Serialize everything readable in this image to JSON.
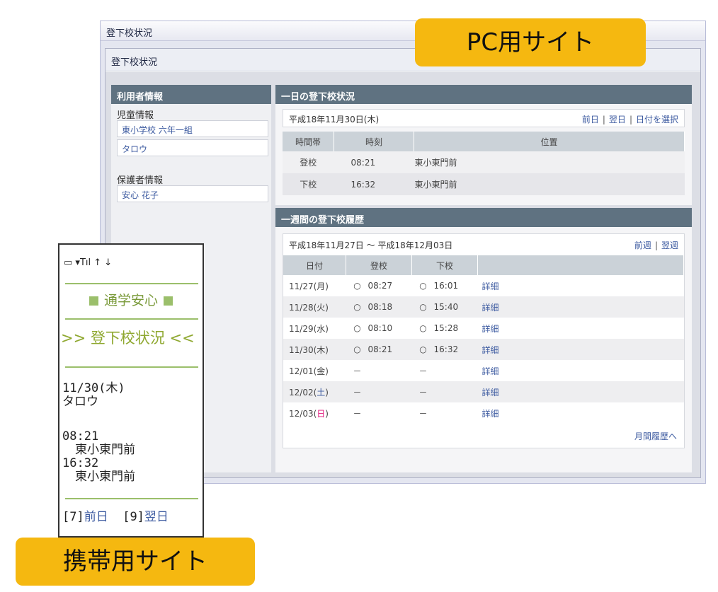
{
  "pc": {
    "window_title": "登下校状況",
    "page_header": "登下校状況",
    "user_panel": {
      "title": "利用者情報",
      "child_label": "児童情報",
      "child_school": "東小学校 六年一組",
      "child_name": "タロウ",
      "guardian_label": "保護者情報",
      "guardian_name": "安心 花子"
    },
    "daily": {
      "title": "一日の登下校状況",
      "date": "平成18年11月30日(木)",
      "nav": [
        "前日",
        "翌日",
        "日付を選択"
      ],
      "nav_sep": "|",
      "headers": [
        "時間帯",
        "時刻",
        "位置"
      ],
      "rows": [
        {
          "period": "登校",
          "time": "08:21",
          "place": "東小東門前"
        },
        {
          "period": "下校",
          "time": "16:32",
          "place": "東小東門前"
        }
      ]
    },
    "weekly": {
      "title": "一週間の登下校履歴",
      "range": "平成18年11月27日 ～ 平成18年12月03日",
      "nav": [
        "前週",
        "翌週"
      ],
      "nav_sep": "|",
      "headers": [
        "日付",
        "登校",
        "下校",
        ""
      ],
      "rows": [
        {
          "date": "11/27",
          "dow": "月",
          "dow_class": "",
          "in_mark": "○",
          "in_time": "08:27",
          "out_mark": "○",
          "out_time": "16:01",
          "detail": "詳細"
        },
        {
          "date": "11/28",
          "dow": "火",
          "dow_class": "",
          "in_mark": "○",
          "in_time": "08:18",
          "out_mark": "○",
          "out_time": "15:40",
          "detail": "詳細"
        },
        {
          "date": "11/29",
          "dow": "水",
          "dow_class": "",
          "in_mark": "○",
          "in_time": "08:10",
          "out_mark": "○",
          "out_time": "15:28",
          "detail": "詳細"
        },
        {
          "date": "11/30",
          "dow": "木",
          "dow_class": "",
          "in_mark": "○",
          "in_time": "08:21",
          "out_mark": "○",
          "out_time": "16:32",
          "detail": "詳細"
        },
        {
          "date": "12/01",
          "dow": "金",
          "dow_class": "",
          "in_mark": "－",
          "in_time": "",
          "out_mark": "－",
          "out_time": "",
          "detail": "詳細"
        },
        {
          "date": "12/02",
          "dow": "土",
          "dow_class": "sat",
          "in_mark": "－",
          "in_time": "",
          "out_mark": "－",
          "out_time": "",
          "detail": "詳細"
        },
        {
          "date": "12/03",
          "dow": "日",
          "dow_class": "sun",
          "in_mark": "－",
          "in_time": "",
          "out_mark": "－",
          "out_time": "",
          "detail": "詳細"
        }
      ],
      "monthly_link": "月間履歴へ"
    }
  },
  "mobile": {
    "status": "▭ ▾Tıl   ↑ ↓",
    "app_title": "通学安心",
    "page_title": ">> 登下校状況 <<",
    "date": "11/30(木)",
    "name": "タロウ",
    "in_time": "08:21",
    "in_place": "東小東門前",
    "out_time": "16:32",
    "out_place": "東小東門前",
    "prev_key": "[7]",
    "prev_label": "前日",
    "next_key": "[9]",
    "next_label": "翌日"
  },
  "badges": {
    "pc": "PC用サイト",
    "mobile": "携帯用サイト"
  },
  "colors": {
    "panel_header": "#5f7281",
    "link": "#3c5aa0",
    "sunday": "#e0147a",
    "mobile_accent": "#9bbf6b",
    "badge": "#f5b810"
  }
}
